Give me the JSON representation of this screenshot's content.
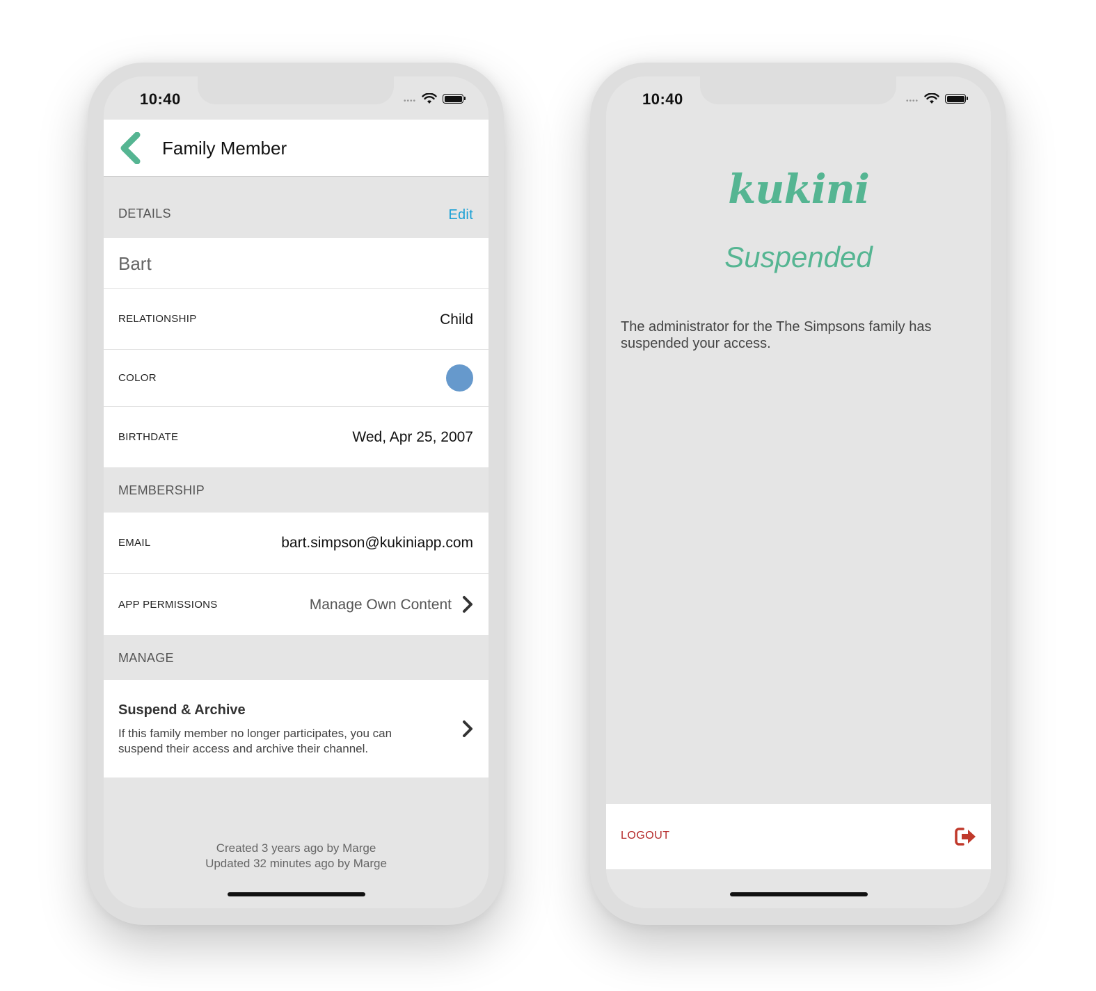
{
  "status": {
    "time": "10:40"
  },
  "family_member": {
    "nav_title": "Family Member",
    "details_header": "DETAILS",
    "edit_label": "Edit",
    "name": "Bart",
    "relationship_label": "RELATIONSHIP",
    "relationship_value": "Child",
    "color_label": "COLOR",
    "color_value": "#6699cc",
    "birthdate_label": "BIRTHDATE",
    "birthdate_value": "Wed, Apr 25, 2007",
    "membership_header": "MEMBERSHIP",
    "email_label": "EMAIL",
    "email_value": "bart.simpson@kukiniapp.com",
    "permissions_label": "APP PERMISSIONS",
    "permissions_value": "Manage Own Content",
    "manage_header": "MANAGE",
    "suspend_title": "Suspend & Archive",
    "suspend_description": "If this family member no longer participates, you can suspend their access and archive their channel.",
    "created_text": "Created 3 years ago by Marge",
    "updated_text": "Updated 32 minutes ago by Marge"
  },
  "suspended_screen": {
    "logo_text": "kukini",
    "heading": "Suspended",
    "message": "The administrator for the The Simpsons family has suspended your access.",
    "logout_label": "LOGOUT"
  },
  "colors": {
    "brand_green": "#55b592",
    "link_blue": "#1aa0d5",
    "logout_red": "#b52a2a"
  },
  "icons": {
    "back": "chevron-left-icon",
    "permissions_chevron": "chevron-right-icon",
    "suspend_chevron": "chevron-right-icon",
    "logout": "sign-out-icon",
    "wifi": "wifi-icon",
    "battery": "battery-icon"
  }
}
